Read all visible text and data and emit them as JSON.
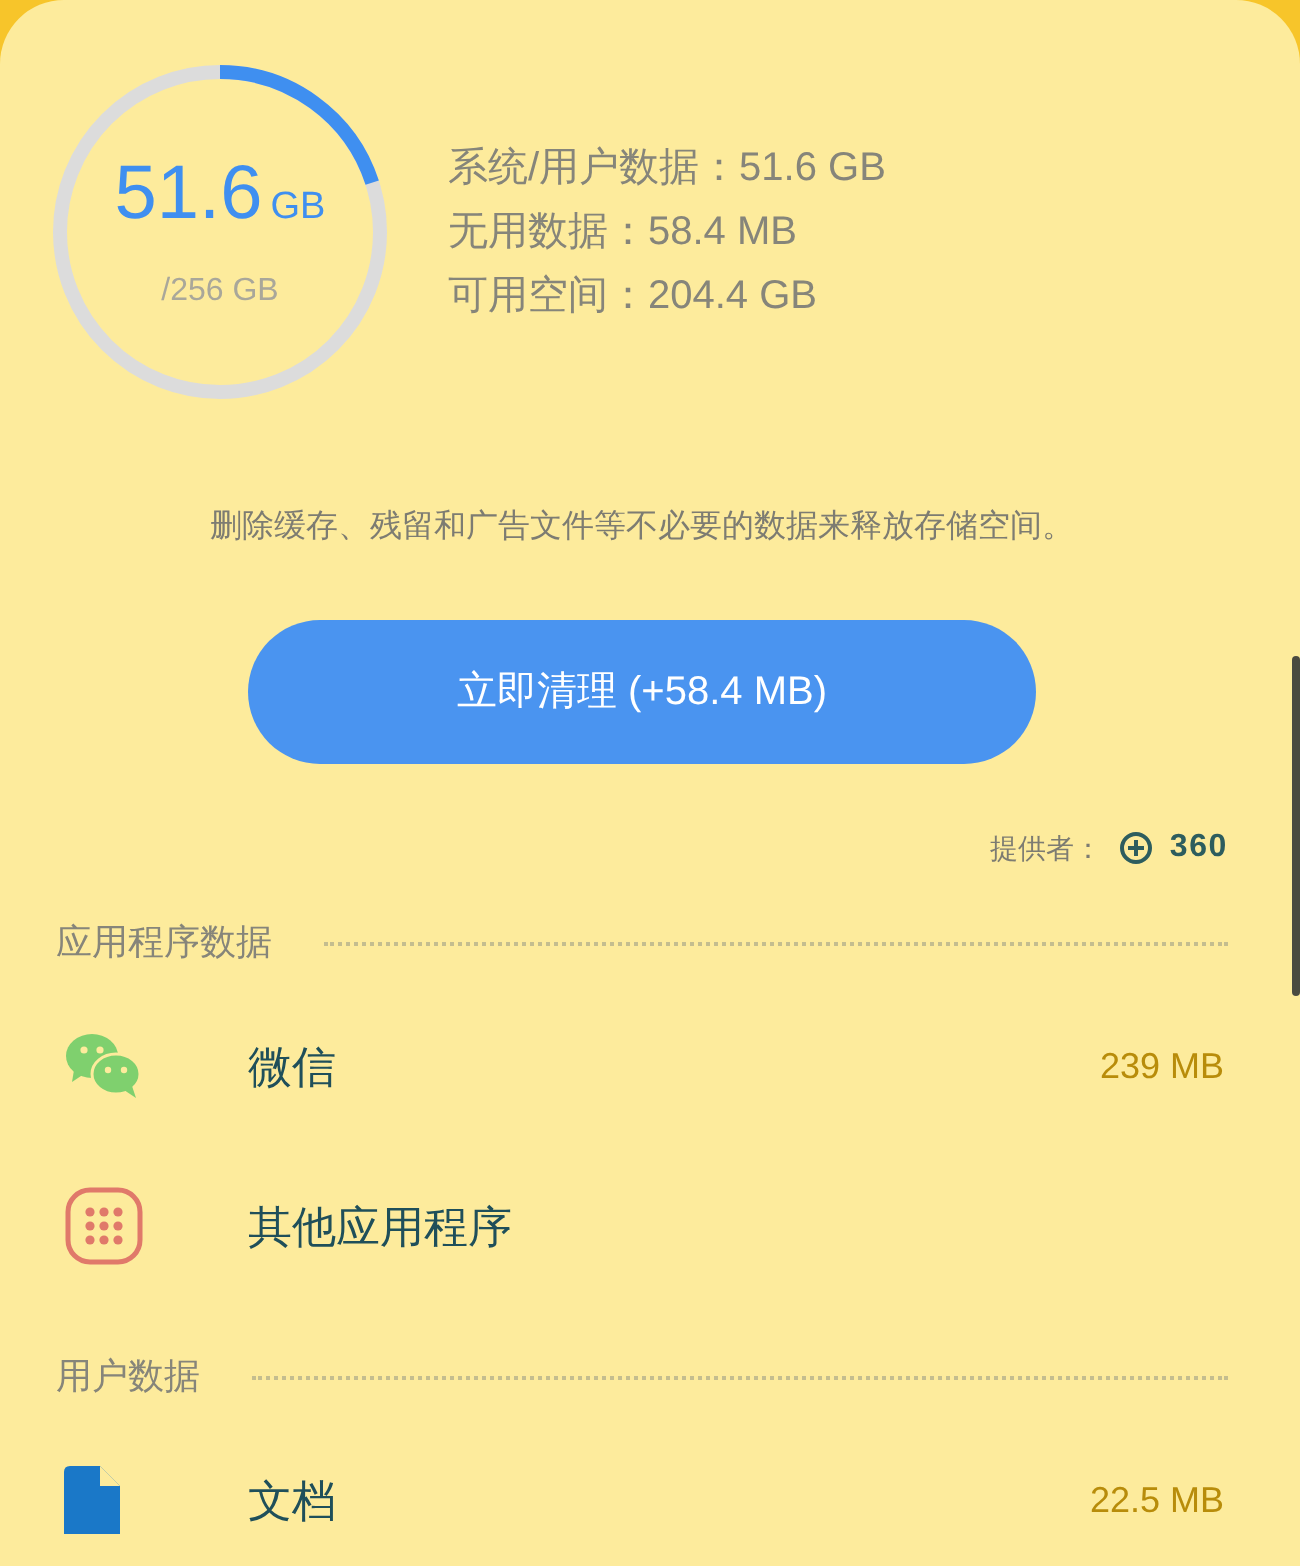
{
  "storage": {
    "used": "51.6",
    "used_unit": "GB",
    "total": "/256 GB",
    "stats": [
      "系统/用户数据：51.6 GB",
      "无用数据：58.4 MB",
      "可用空间：204.4 GB"
    ]
  },
  "description": "删除缓存、残留和广告文件等不必要的数据来释放存储空间。",
  "clean_button": "立即清理 (+58.4 MB)",
  "provider": {
    "label": "提供者：",
    "brand": "360"
  },
  "sections": [
    {
      "title": "应用程序数据",
      "items": [
        {
          "kind": "chat",
          "name": "微信",
          "size": "239 MB"
        },
        {
          "kind": "apps",
          "name": "其他应用程序"
        }
      ]
    },
    {
      "title": "用户数据",
      "items": [
        {
          "kind": "document",
          "name": "文档",
          "size": "22.5 MB"
        }
      ]
    }
  ]
}
